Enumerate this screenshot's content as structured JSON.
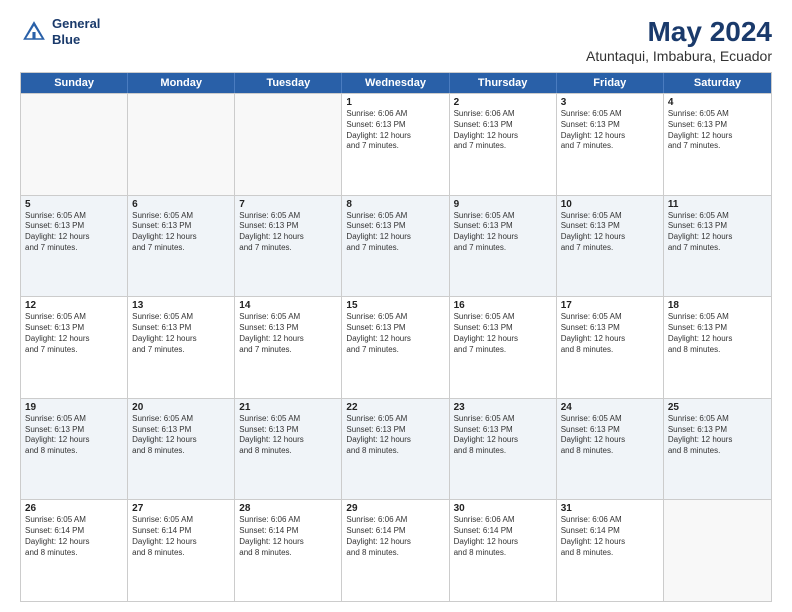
{
  "logo": {
    "line1": "General",
    "line2": "Blue"
  },
  "title": "May 2024",
  "subtitle": "Atuntaqui, Imbabura, Ecuador",
  "header_days": [
    "Sunday",
    "Monday",
    "Tuesday",
    "Wednesday",
    "Thursday",
    "Friday",
    "Saturday"
  ],
  "rows": [
    [
      {
        "day": "",
        "info": ""
      },
      {
        "day": "",
        "info": ""
      },
      {
        "day": "",
        "info": ""
      },
      {
        "day": "1",
        "info": "Sunrise: 6:06 AM\nSunset: 6:13 PM\nDaylight: 12 hours\nand 7 minutes."
      },
      {
        "day": "2",
        "info": "Sunrise: 6:06 AM\nSunset: 6:13 PM\nDaylight: 12 hours\nand 7 minutes."
      },
      {
        "day": "3",
        "info": "Sunrise: 6:05 AM\nSunset: 6:13 PM\nDaylight: 12 hours\nand 7 minutes."
      },
      {
        "day": "4",
        "info": "Sunrise: 6:05 AM\nSunset: 6:13 PM\nDaylight: 12 hours\nand 7 minutes."
      }
    ],
    [
      {
        "day": "5",
        "info": "Sunrise: 6:05 AM\nSunset: 6:13 PM\nDaylight: 12 hours\nand 7 minutes."
      },
      {
        "day": "6",
        "info": "Sunrise: 6:05 AM\nSunset: 6:13 PM\nDaylight: 12 hours\nand 7 minutes."
      },
      {
        "day": "7",
        "info": "Sunrise: 6:05 AM\nSunset: 6:13 PM\nDaylight: 12 hours\nand 7 minutes."
      },
      {
        "day": "8",
        "info": "Sunrise: 6:05 AM\nSunset: 6:13 PM\nDaylight: 12 hours\nand 7 minutes."
      },
      {
        "day": "9",
        "info": "Sunrise: 6:05 AM\nSunset: 6:13 PM\nDaylight: 12 hours\nand 7 minutes."
      },
      {
        "day": "10",
        "info": "Sunrise: 6:05 AM\nSunset: 6:13 PM\nDaylight: 12 hours\nand 7 minutes."
      },
      {
        "day": "11",
        "info": "Sunrise: 6:05 AM\nSunset: 6:13 PM\nDaylight: 12 hours\nand 7 minutes."
      }
    ],
    [
      {
        "day": "12",
        "info": "Sunrise: 6:05 AM\nSunset: 6:13 PM\nDaylight: 12 hours\nand 7 minutes."
      },
      {
        "day": "13",
        "info": "Sunrise: 6:05 AM\nSunset: 6:13 PM\nDaylight: 12 hours\nand 7 minutes."
      },
      {
        "day": "14",
        "info": "Sunrise: 6:05 AM\nSunset: 6:13 PM\nDaylight: 12 hours\nand 7 minutes."
      },
      {
        "day": "15",
        "info": "Sunrise: 6:05 AM\nSunset: 6:13 PM\nDaylight: 12 hours\nand 7 minutes."
      },
      {
        "day": "16",
        "info": "Sunrise: 6:05 AM\nSunset: 6:13 PM\nDaylight: 12 hours\nand 7 minutes."
      },
      {
        "day": "17",
        "info": "Sunrise: 6:05 AM\nSunset: 6:13 PM\nDaylight: 12 hours\nand 8 minutes."
      },
      {
        "day": "18",
        "info": "Sunrise: 6:05 AM\nSunset: 6:13 PM\nDaylight: 12 hours\nand 8 minutes."
      }
    ],
    [
      {
        "day": "19",
        "info": "Sunrise: 6:05 AM\nSunset: 6:13 PM\nDaylight: 12 hours\nand 8 minutes."
      },
      {
        "day": "20",
        "info": "Sunrise: 6:05 AM\nSunset: 6:13 PM\nDaylight: 12 hours\nand 8 minutes."
      },
      {
        "day": "21",
        "info": "Sunrise: 6:05 AM\nSunset: 6:13 PM\nDaylight: 12 hours\nand 8 minutes."
      },
      {
        "day": "22",
        "info": "Sunrise: 6:05 AM\nSunset: 6:13 PM\nDaylight: 12 hours\nand 8 minutes."
      },
      {
        "day": "23",
        "info": "Sunrise: 6:05 AM\nSunset: 6:13 PM\nDaylight: 12 hours\nand 8 minutes."
      },
      {
        "day": "24",
        "info": "Sunrise: 6:05 AM\nSunset: 6:13 PM\nDaylight: 12 hours\nand 8 minutes."
      },
      {
        "day": "25",
        "info": "Sunrise: 6:05 AM\nSunset: 6:13 PM\nDaylight: 12 hours\nand 8 minutes."
      }
    ],
    [
      {
        "day": "26",
        "info": "Sunrise: 6:05 AM\nSunset: 6:14 PM\nDaylight: 12 hours\nand 8 minutes."
      },
      {
        "day": "27",
        "info": "Sunrise: 6:05 AM\nSunset: 6:14 PM\nDaylight: 12 hours\nand 8 minutes."
      },
      {
        "day": "28",
        "info": "Sunrise: 6:06 AM\nSunset: 6:14 PM\nDaylight: 12 hours\nand 8 minutes."
      },
      {
        "day": "29",
        "info": "Sunrise: 6:06 AM\nSunset: 6:14 PM\nDaylight: 12 hours\nand 8 minutes."
      },
      {
        "day": "30",
        "info": "Sunrise: 6:06 AM\nSunset: 6:14 PM\nDaylight: 12 hours\nand 8 minutes."
      },
      {
        "day": "31",
        "info": "Sunrise: 6:06 AM\nSunset: 6:14 PM\nDaylight: 12 hours\nand 8 minutes."
      },
      {
        "day": "",
        "info": ""
      }
    ]
  ]
}
